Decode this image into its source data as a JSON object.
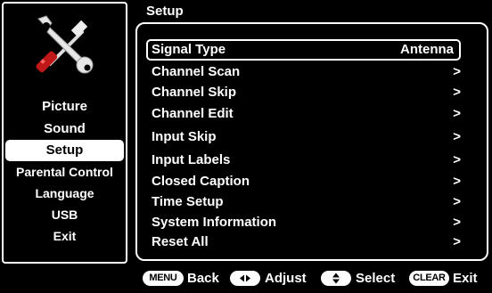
{
  "panel_title": "Setup",
  "left_menu": {
    "items": [
      {
        "label": "Picture"
      },
      {
        "label": "Sound"
      },
      {
        "label": "Setup",
        "selected": true
      },
      {
        "label": "Parental Control"
      },
      {
        "label": "Language"
      },
      {
        "label": "USB"
      },
      {
        "label": "Exit"
      }
    ],
    "icon": "tools-icon"
  },
  "setup_menu": {
    "rows": [
      {
        "label": "Signal Type",
        "value": "Antenna",
        "highlighted": true
      },
      {
        "label": "Channel Scan",
        "arrow": ">"
      },
      {
        "label": "Channel Skip",
        "arrow": ">"
      },
      {
        "label": "Channel Edit",
        "arrow": ">"
      },
      {
        "label": "Input Skip",
        "arrow": ">"
      },
      {
        "label": "Input Labels",
        "arrow": ">"
      },
      {
        "label": "Closed Caption",
        "arrow": ">"
      },
      {
        "label": "Time Setup",
        "arrow": ">"
      },
      {
        "label": "System Information",
        "arrow": ">"
      },
      {
        "label": "Reset All",
        "arrow": ">"
      }
    ]
  },
  "help_bar": {
    "menu_key": "MENU",
    "back": "Back",
    "adjust_icon": "left-right-arrows-icon",
    "adjust": "Adjust",
    "select_icon": "up-down-arrows-icon",
    "select": "Select",
    "clear_key": "CLEAR",
    "exit": "Exit"
  }
}
